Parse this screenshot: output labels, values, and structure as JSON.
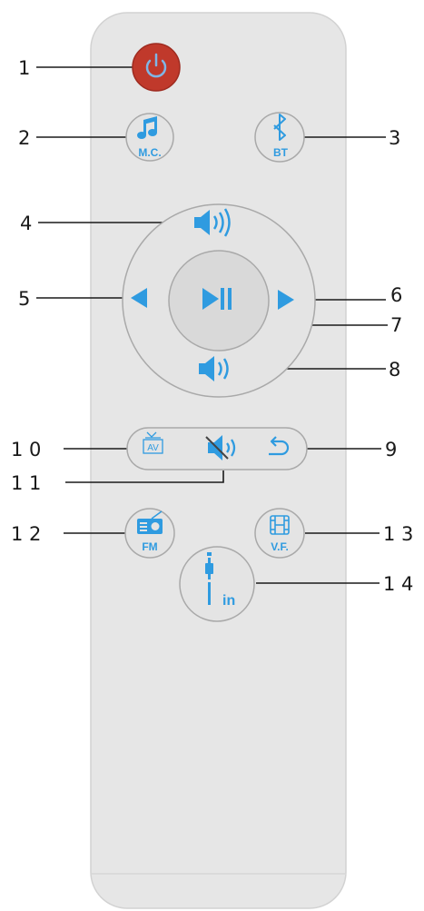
{
  "colors": {
    "body": "#e6e6e6",
    "body_stroke": "#d2d2d2",
    "button_face": "#e4e4e4",
    "button_stroke": "#a9a9a9",
    "accent": "#2f9be0",
    "power": "#c0392b",
    "line": "#1a1a1a"
  },
  "buttons": {
    "power": {
      "icon": "power-icon"
    },
    "mc": {
      "icon": "music-note-icon",
      "label": "M.C."
    },
    "bt": {
      "icon": "bluetooth-icon",
      "label": "BT"
    },
    "vol_up": {
      "icon": "volume-up-icon"
    },
    "prev": {
      "icon": "prev-triangle-icon"
    },
    "play_pause": {
      "icon": "play-pause-icon"
    },
    "next": {
      "icon": "next-triangle-icon"
    },
    "vol_down": {
      "icon": "volume-down-icon"
    },
    "av": {
      "icon": "tv-icon",
      "label": "AV"
    },
    "mute": {
      "icon": "mute-icon"
    },
    "back": {
      "icon": "return-icon"
    },
    "fm": {
      "icon": "radio-icon",
      "label": "FM"
    },
    "vf": {
      "icon": "film-icon",
      "label": "V.F."
    },
    "line_in": {
      "icon": "plug-icon",
      "label": "in"
    }
  },
  "callouts": {
    "c1": "1",
    "c2": "2",
    "c3": "3",
    "c4": "4",
    "c5": "5",
    "c6": "6",
    "c7": "7",
    "c8": "8",
    "c9": "9",
    "c10": "1 0",
    "c11": "1 1",
    "c12": "1 2",
    "c13": "1 3",
    "c14": "1 4"
  }
}
